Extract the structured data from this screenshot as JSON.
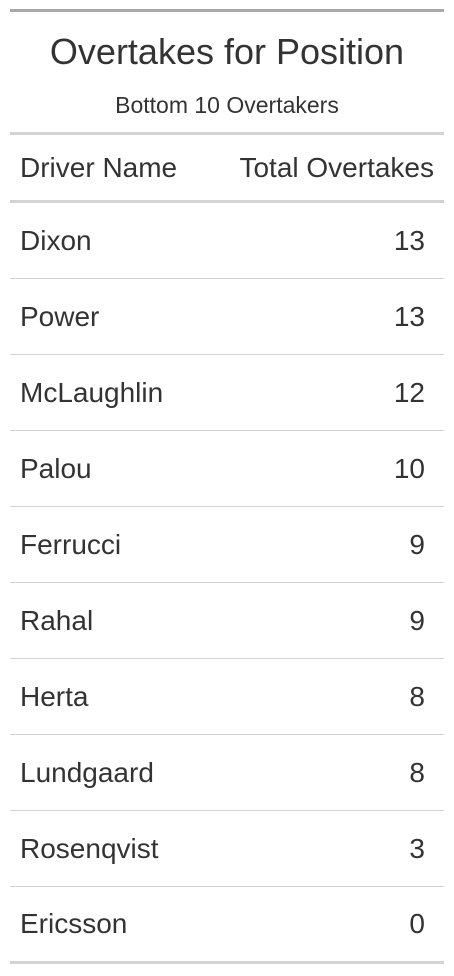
{
  "chart_data": {
    "type": "table",
    "title": "Overtakes for Position",
    "subtitle": "Bottom 10 Overtakers",
    "columns": [
      "Driver Name",
      "Total Overtakes"
    ],
    "rows": [
      {
        "driver": "Dixon",
        "overtakes": 13
      },
      {
        "driver": "Power",
        "overtakes": 13
      },
      {
        "driver": "McLaughlin",
        "overtakes": 12
      },
      {
        "driver": "Palou",
        "overtakes": 10
      },
      {
        "driver": "Ferrucci",
        "overtakes": 9
      },
      {
        "driver": "Rahal",
        "overtakes": 9
      },
      {
        "driver": "Herta",
        "overtakes": 8
      },
      {
        "driver": "Lundgaard",
        "overtakes": 8
      },
      {
        "driver": "Rosenqvist",
        "overtakes": 3
      },
      {
        "driver": "Ericsson",
        "overtakes": 0
      }
    ]
  }
}
